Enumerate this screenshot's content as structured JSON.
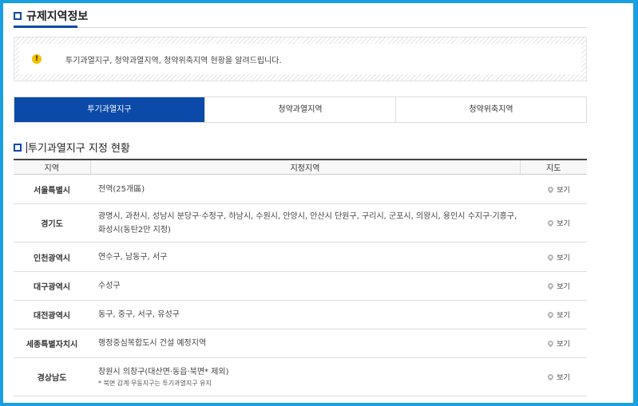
{
  "page": {
    "title": "규제지역정보"
  },
  "notice": {
    "text": "투기과열지구, 청약과열지역, 청약위축지역 현황을 알려드립니다."
  },
  "tabs": [
    {
      "label": "투기과열지구",
      "active": true
    },
    {
      "label": "청약과열지역",
      "active": false
    },
    {
      "label": "청약위축지역",
      "active": false
    }
  ],
  "section": {
    "title": "투기과열지구 지정 현황"
  },
  "table": {
    "headers": {
      "region": "지역",
      "areas": "지정지역",
      "map": "지도"
    },
    "view_label": "보기",
    "rows": [
      {
        "region": "서울특별시",
        "areas": "전역(25개區)",
        "note": ""
      },
      {
        "region": "경기도",
        "areas": "광명시, 과천시, 성남시 분당구·수정구, 하남시, 수원시, 안양시, 안산시 단원구, 구리시, 군포시, 의왕시, 용인시 수지구·기흥구, 화성시(동탄2만 지정)",
        "note": ""
      },
      {
        "region": "인천광역시",
        "areas": "연수구, 남동구, 서구",
        "note": ""
      },
      {
        "region": "대구광역시",
        "areas": "수성구",
        "note": ""
      },
      {
        "region": "대전광역시",
        "areas": "동구, 중구, 서구, 유성구",
        "note": ""
      },
      {
        "region": "세종특별자치시",
        "areas": "행정중심복합도시 건설 예정지역",
        "note": ""
      },
      {
        "region": "경상남도",
        "areas": "창원시 의창구(대산면·동읍·북면* 제외)",
        "note": "* 북면 감계·무동지구는 투기과열지구 유지"
      }
    ]
  },
  "colors": {
    "accent": "#0b4aa8",
    "frame": "#1aa0e0",
    "warning": "#f2c200"
  }
}
